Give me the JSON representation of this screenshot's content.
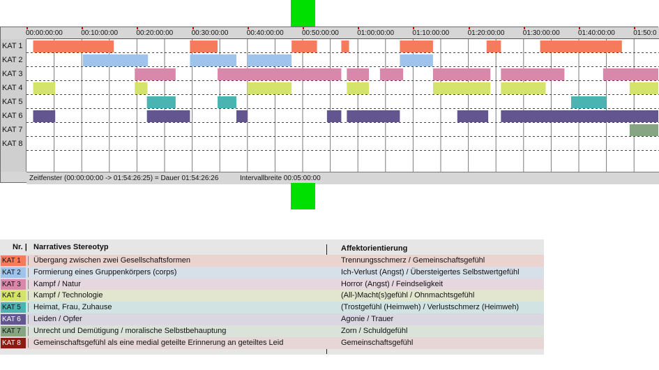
{
  "timeline": {
    "ruler_ticks": [
      "00:00:00:00",
      "00:10:00:00",
      "00:20:00:00",
      "00:30:00:00",
      "00:40:00:00",
      "00:50:00:00",
      "01:00:00:00",
      "01:10:00:00",
      "01:20:00:00",
      "01:30:00:00",
      "01:40:00:00",
      "01:50:0"
    ],
    "row_labels": [
      "KAT 1",
      "KAT 2",
      "KAT 3",
      "KAT 4",
      "KAT 5",
      "KAT 6",
      "KAT 7",
      "KAT 8"
    ],
    "status_window": "Zeitfenster (00:00:00:00 -> 01:54:26:25) = Dauer 01:54:26:26",
    "status_interval": "Intervallbreite 00:05:00:00",
    "colors": {
      "KAT 1": "#f47c5a",
      "KAT 2": "#9ec4ee",
      "KAT 3": "#d988ab",
      "KAT 4": "#d4e36a",
      "KAT 5": "#4cb3b3",
      "KAT 6": "#63558f",
      "KAT 7": "#86a683",
      "KAT 8": "#8b1c12"
    },
    "segments_minutes": [
      [
        [
          1.2,
          15.8
        ],
        [
          29.6,
          34.6
        ],
        [
          48.0,
          52.6
        ],
        [
          57.0,
          58.4
        ],
        [
          67.6,
          73.6
        ],
        [
          83.3,
          85.9
        ],
        [
          93.0,
          107.8
        ]
      ],
      [
        [
          10.2,
          22.0
        ],
        [
          29.6,
          38.0
        ],
        [
          40.0,
          48.0
        ],
        [
          67.6,
          73.6
        ]
      ],
      [
        [
          19.6,
          27.0
        ],
        [
          34.6,
          57.0
        ],
        [
          58.0,
          62.0
        ],
        [
          64.0,
          68.2
        ],
        [
          73.6,
          84.0
        ],
        [
          85.9,
          97.4
        ],
        [
          104.4,
          114.4
        ]
      ],
      [
        [
          1.2,
          5.2
        ],
        [
          19.6,
          21.9
        ],
        [
          40.0,
          48.0
        ],
        [
          58.0,
          62.0
        ],
        [
          73.6,
          84.0
        ],
        [
          85.9,
          94.0
        ],
        [
          109.2,
          114.4
        ]
      ],
      [
        [
          21.8,
          27.0
        ],
        [
          34.6,
          38.0
        ],
        [
          98.6,
          105.0
        ]
      ],
      [
        [
          1.2,
          5.2
        ],
        [
          21.8,
          29.6
        ],
        [
          38.0,
          40.0
        ],
        [
          54.4,
          57.0
        ],
        [
          58.0,
          67.6
        ],
        [
          78.0,
          83.6
        ],
        [
          85.9,
          114.4
        ]
      ],
      [
        [
          109.2,
          114.4
        ]
      ],
      []
    ]
  },
  "legend": {
    "header_nr": "Nr. |",
    "header_story": "Narratives Stereotyp",
    "header_affect": "Affektorientierung",
    "rows": [
      {
        "kat": "KAT 1",
        "story": "Übergang zwischen zwei Gesellschaftsformen",
        "affect": "Trennungsschmerz / Gemeinschaftsgefühl",
        "swatch": "#f47c5a",
        "row_bg": "#ebd4cf",
        "text": "#111111"
      },
      {
        "kat": "KAT 2",
        "story": "Formierung eines Gruppenkörpers (corps)",
        "affect": "Ich-Verlust (Angst) / Übersteigertes Selbstwertgefühl",
        "swatch": "#9ec4ee",
        "row_bg": "#d7dfe9",
        "text": "#111111"
      },
      {
        "kat": "KAT 3",
        "story": "Kampf / Natur",
        "affect": "Horror (Angst) / Feindseligkeit",
        "swatch": "#d988ab",
        "row_bg": "#e6d6dd",
        "text": "#111111"
      },
      {
        "kat": "KAT 4",
        "story": "Kampf / Technologie",
        "affect": "(All-)Macht(s)gefühl / Ohnmachtsgefühl",
        "swatch": "#d4e36a",
        "row_bg": "#e3e6cf",
        "text": "#111111"
      },
      {
        "kat": "KAT 5",
        "story": "Heimat, Frau, Zuhause",
        "affect": "(Trostgefühl (Heimweh) / Verlustschmerz (Heimweh)",
        "swatch": "#4cb3b3",
        "row_bg": "#d2e3e3",
        "text": "#111111"
      },
      {
        "kat": "KAT 6",
        "story": "Leiden / Opfer",
        "affect": "Agonie / Trauer",
        "swatch": "#63558f",
        "row_bg": "#dad7e3",
        "text": "#ffffff"
      },
      {
        "kat": "KAT 7",
        "story": "Unrecht und Demütigung / moralische Selbstbehauptung",
        "affect": "Zorn / Schuldgefühl",
        "swatch": "#86a683",
        "row_bg": "#dbe2da",
        "text": "#111111"
      },
      {
        "kat": "KAT 8",
        "story": "Gemeinschaftsgefühl als eine medial geteilte Erinnerung an geteiltes Leid",
        "affect": "Gemeinschaftsgefühl",
        "swatch": "#8b1c12",
        "row_bg": "#e6d6d6",
        "text": "#ffffff"
      }
    ]
  }
}
